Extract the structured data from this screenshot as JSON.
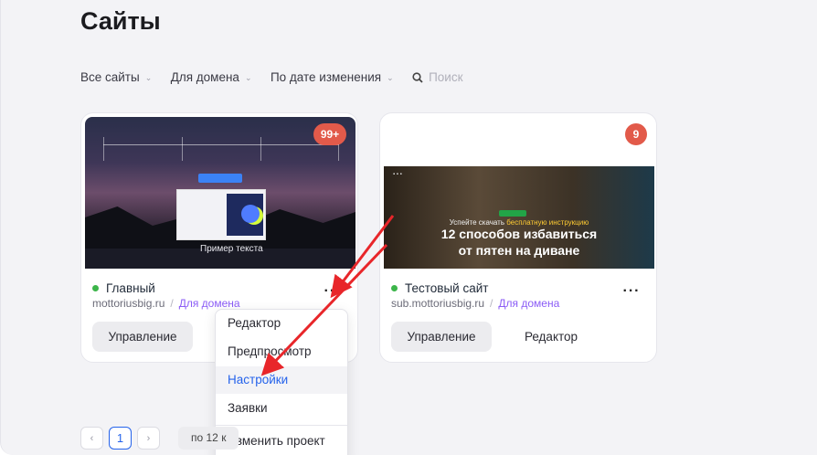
{
  "page": {
    "title": "Сайты"
  },
  "filters": {
    "all_sites": "Все сайты",
    "for_domain": "Для домена",
    "by_date": "По дате изменения",
    "search_placeholder": "Поиск"
  },
  "cards": [
    {
      "badge": "99+",
      "name": "Главный",
      "domain": "mottoriusbig.ru",
      "domain_link": "Для домена",
      "manage_label": "Управление",
      "thumb_caption": "Пример текста",
      "status_color": "#3cb54a"
    },
    {
      "badge": "9",
      "name": "Тестовый сайт",
      "domain": "sub.mottoriusbig.ru",
      "domain_link": "Для домена",
      "manage_label": "Управление",
      "editor_label": "Редактор",
      "hero_sub_prefix": "Успейте скачать",
      "hero_sub_highlight": "бесплатную инструкцию",
      "hero_title_1": "12 способов избавиться",
      "hero_title_2": "от пятен на диване",
      "status_color": "#3cb54a"
    }
  ],
  "menu": {
    "items": [
      "Редактор",
      "Предпросмотр",
      "Настройки",
      "Заявки",
      "Изменить проект"
    ],
    "active_index": 2
  },
  "pagination": {
    "prev": "‹",
    "current": "1",
    "next": "›",
    "per_page": "по 12 к"
  },
  "colors": {
    "accent": "#2563eb",
    "badge": "#e25a4a",
    "link": "#8b5cf6",
    "annotation_arrow": "#e8262a"
  }
}
